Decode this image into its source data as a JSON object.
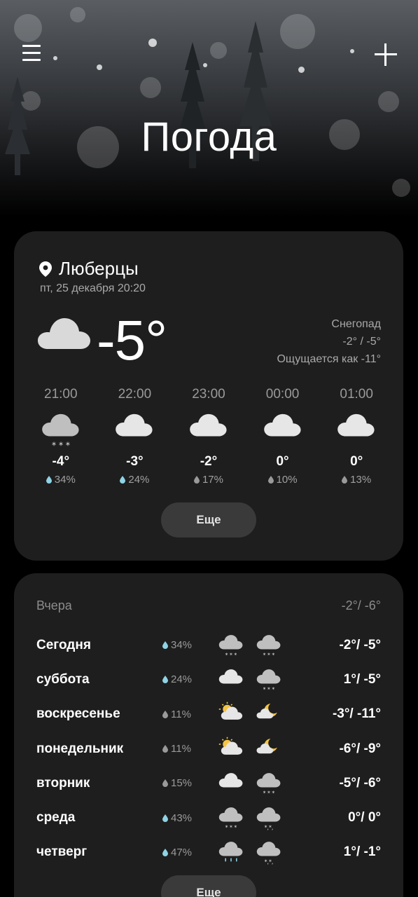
{
  "header": {
    "title": "Погода",
    "menu_icon": "menu-icon",
    "add_icon": "plus-icon"
  },
  "current": {
    "city": "Люберцы",
    "datetime": "пт, 25 декабря 20:20",
    "temperature": "-5°",
    "condition": "Снегопад",
    "range": "-2° / -5°",
    "feels_like": "Ощущается как -11°",
    "icon": "cloud-icon"
  },
  "hourly": [
    {
      "time": "21:00",
      "temp": "-4°",
      "pop": "34%",
      "icon": "snow-cloud-icon",
      "drop_color": "#8fd3e6"
    },
    {
      "time": "22:00",
      "temp": "-3°",
      "pop": "24%",
      "icon": "cloud-icon",
      "drop_color": "#8fd3e6"
    },
    {
      "time": "23:00",
      "temp": "-2°",
      "pop": "17%",
      "icon": "cloud-icon",
      "drop_color": "#9a9a9a"
    },
    {
      "time": "00:00",
      "temp": "0°",
      "pop": "10%",
      "icon": "cloud-icon",
      "drop_color": "#9a9a9a"
    },
    {
      "time": "01:00",
      "temp": "0°",
      "pop": "13%",
      "icon": "cloud-icon",
      "drop_color": "#9a9a9a"
    }
  ],
  "more_label": "Еще",
  "yesterday": {
    "label": "Вчера",
    "range": "-2°/ -6°"
  },
  "daily": [
    {
      "day": "Сегодня",
      "pop": "34%",
      "day_icon": "snow-cloud-icon",
      "night_icon": "snow-cloud-icon",
      "range": "-2°/ -5°",
      "drop_color": "#8fd3e6"
    },
    {
      "day": "суббота",
      "pop": "24%",
      "day_icon": "cloud-icon",
      "night_icon": "snow-cloud-icon",
      "range": "1°/ -5°",
      "drop_color": "#8fd3e6"
    },
    {
      "day": "воскресенье",
      "pop": "11%",
      "day_icon": "sun-cloud-icon",
      "night_icon": "moon-cloud-icon",
      "range": "-3°/ -11°",
      "drop_color": "#9a9a9a"
    },
    {
      "day": "понедельник",
      "pop": "11%",
      "day_icon": "sun-cloud-icon",
      "night_icon": "moon-cloud-icon",
      "range": "-6°/ -9°",
      "drop_color": "#9a9a9a"
    },
    {
      "day": "вторник",
      "pop": "15%",
      "day_icon": "cloud-icon",
      "night_icon": "snow-cloud-icon",
      "range": "-5°/ -6°",
      "drop_color": "#9a9a9a"
    },
    {
      "day": "среда",
      "pop": "43%",
      "day_icon": "snow-cloud-icon",
      "night_icon": "sleet-cloud-icon",
      "range": "0°/ 0°",
      "drop_color": "#8fd3e6"
    },
    {
      "day": "четверг",
      "pop": "47%",
      "day_icon": "rain-cloud-icon",
      "night_icon": "sleet-cloud-icon",
      "range": "1°/ -1°",
      "drop_color": "#8fd3e6"
    }
  ],
  "colors": {
    "background": "#000000",
    "card": "#1e1e1e",
    "button": "#3a3a3a",
    "secondary_text": "#a9a9a9",
    "precip_accent": "#8fd3e6",
    "sun": "#f5c542"
  }
}
